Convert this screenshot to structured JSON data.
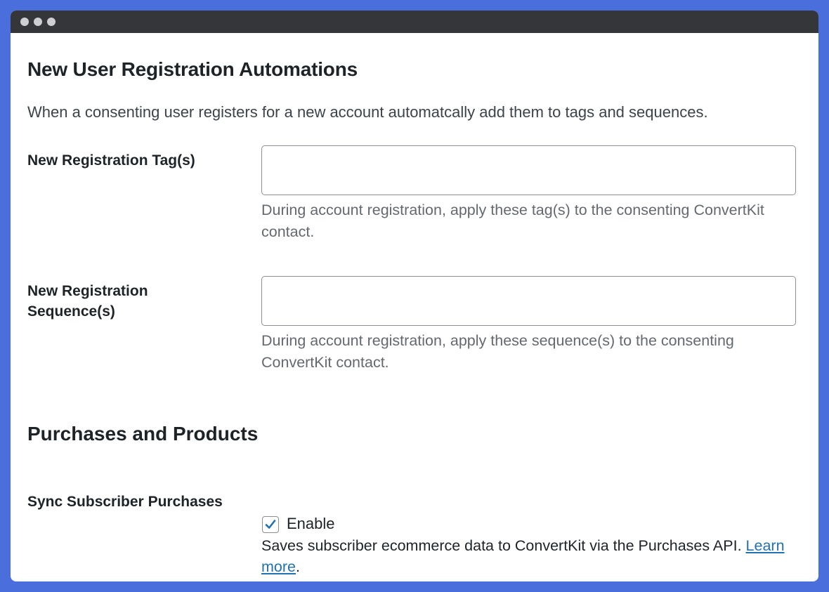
{
  "window": {
    "controls": [
      "close-dot",
      "minimize-dot",
      "maximize-dot"
    ]
  },
  "registration": {
    "heading": "New User Registration Automations",
    "intro": "When a consenting user registers for a new account automatcally add them to tags and sequences.",
    "tags_label": "New Registration Tag(s)",
    "tags_value": "",
    "tags_desc": "During account registration, apply these tag(s) to the consenting ConvertKit contact.",
    "sequences_label": "New Registration Sequence(s)",
    "sequences_value": "",
    "sequences_desc": "During account registration, apply these sequence(s) to the consenting ConvertKit contact."
  },
  "purchases": {
    "heading": "Purchases and Products",
    "sync_label": "Sync Subscriber Purchases",
    "enable_label": "Enable",
    "enable_checked": true,
    "sync_desc": "Saves subscriber ecommerce data to ConvertKit via the Purchases API.",
    "learn_more": "Learn more",
    "trailing": "."
  },
  "colors": {
    "background": "#4a6fdc",
    "link": "#2271b1",
    "checkmark": "#2271b1"
  }
}
